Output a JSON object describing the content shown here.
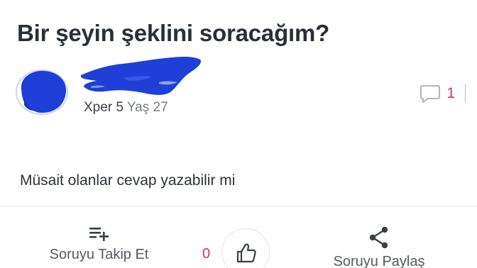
{
  "question": {
    "title": "Bir şeyin şeklini soracağım?",
    "body": "Müsait olanlar cevap yazabilir mi"
  },
  "author": {
    "level": "Xper 5",
    "age": "Yaş 27",
    "avatar_icon": "redacted-avatar",
    "name_icon": "redacted-username-scribble"
  },
  "comments": {
    "count": "1",
    "icon": "comment-bubble-icon"
  },
  "actions": {
    "follow_label": "Soruyu Takip Et",
    "follow_icon": "playlist-add-icon",
    "like_count": "0",
    "like_icon": "thumbs-up-icon",
    "share_label": "Soruyu Paylaş",
    "share_icon": "share-icon"
  },
  "colors": {
    "accent": "#c7337a",
    "title": "#2a2f37",
    "redaction": "#1f3fd8"
  }
}
